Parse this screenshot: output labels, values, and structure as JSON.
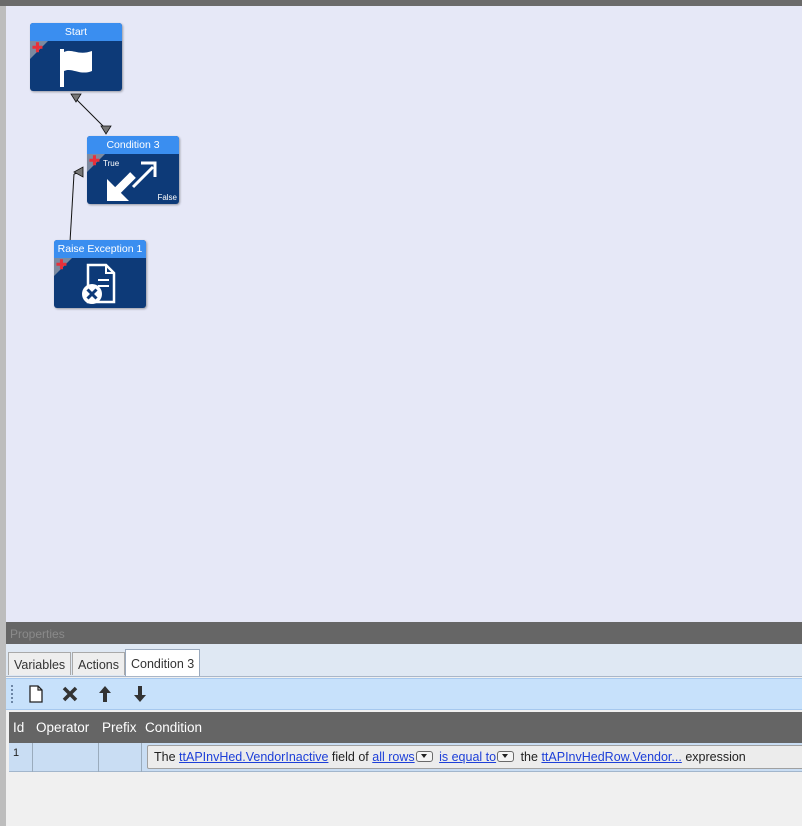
{
  "canvas": {
    "nodes": [
      {
        "id": "start",
        "title": "Start",
        "icon": "flag-icon"
      },
      {
        "id": "condition",
        "title": "Condition 3",
        "icon": "diagonal-arrows-icon",
        "true_label": "True",
        "false_label": "False"
      },
      {
        "id": "raise",
        "title": "Raise Exception 1",
        "icon": "document-error-icon"
      }
    ],
    "connectors": [
      {
        "from": "start",
        "to": "condition"
      },
      {
        "from": "condition",
        "to": "raise",
        "branch": "True"
      }
    ]
  },
  "properties": {
    "header": "Properties",
    "tabs": [
      {
        "label": "Variables",
        "active": false
      },
      {
        "label": "Actions",
        "active": false
      },
      {
        "label": "Condition 3",
        "active": true
      }
    ],
    "toolbar": [
      "new-icon",
      "delete-icon",
      "move-up-icon",
      "move-down-icon"
    ],
    "grid": {
      "columns": [
        "Id",
        "Operator",
        "Prefix",
        "Condition"
      ],
      "rows": [
        {
          "id": "1",
          "operator": "",
          "prefix": "",
          "condition": {
            "the1": "The",
            "field": "ttAPInvHed.VendorInactive",
            "field_of": "field of",
            "rows": "all rows",
            "operator": "is equal to",
            "the2": "the",
            "expr": "ttAPInvHedRow.Vendor...",
            "expression": "expression"
          }
        }
      ]
    }
  },
  "colors": {
    "canvas": "#e6e8f7",
    "node_body": "#0d3a78",
    "node_title": "#3a8ef0",
    "plus": "#e8303a",
    "toolbar": "#c7e1fb",
    "grid_header": "#656565",
    "row": "#c9ddf3",
    "link": "#1d3fd8"
  }
}
